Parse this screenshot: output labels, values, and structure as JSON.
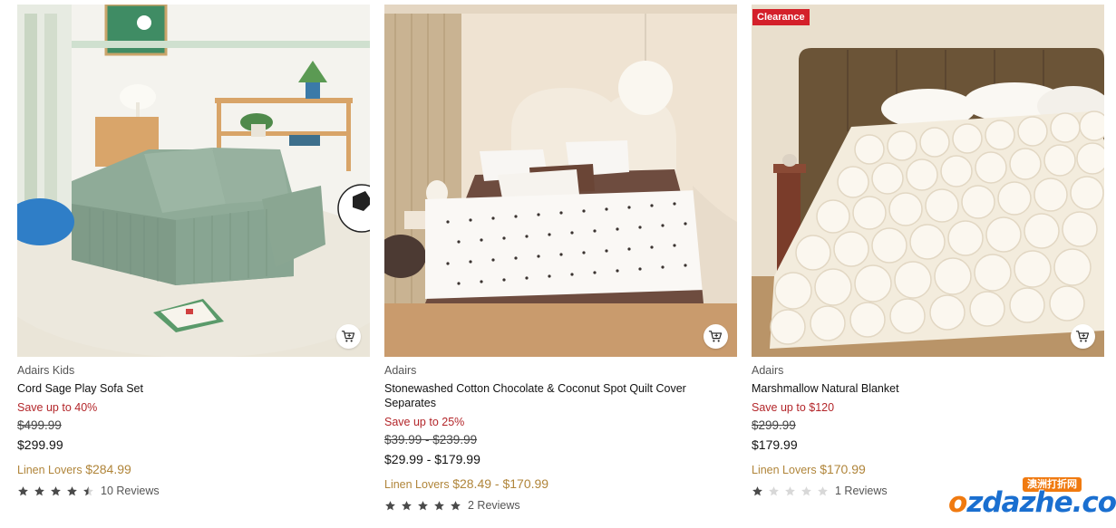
{
  "products": [
    {
      "badge": "",
      "brand": "Adairs Kids",
      "title": "Cord Sage Play Sofa Set",
      "save": "Save up to 40%",
      "was_price": "$499.99",
      "now_price": "$299.99",
      "member_label": "Linen Lovers",
      "member_price": "$284.99",
      "rating": 4.5,
      "reviews": "10 Reviews",
      "image_desc": "sage-corduroy-play-sofa"
    },
    {
      "badge": "",
      "brand": "Adairs",
      "title": "Stonewashed Cotton Chocolate & Coconut Spot Quilt Cover Separates",
      "save": "Save up to 25%",
      "was_price": "$39.99 - $239.99",
      "now_price": "$29.99 - $179.99",
      "member_label": "Linen Lovers",
      "member_price": "$28.49 - $170.99",
      "rating": 5,
      "reviews": "2 Reviews",
      "image_desc": "spot-quilt-cover-bedroom"
    },
    {
      "badge": "Clearance",
      "brand": "Adairs",
      "title": "Marshmallow Natural Blanket",
      "save": "Save up to $120",
      "was_price": "$299.99",
      "now_price": "$179.99",
      "member_label": "Linen Lovers",
      "member_price": "$170.99",
      "rating": 1,
      "reviews": "1 Reviews",
      "image_desc": "marshmallow-puffy-blanket"
    }
  ],
  "icons": {
    "cart": "add-to-cart-icon",
    "star": "star-icon"
  },
  "colors": {
    "save_red": "#b3262a",
    "member_gold": "#b0853a",
    "badge_red": "#d4202a",
    "star_filled": "#4a4a4a",
    "star_empty": "#d8d8d8"
  },
  "watermark": {
    "cn": "澳洲打折网",
    "en": "ozdazhe.com"
  }
}
